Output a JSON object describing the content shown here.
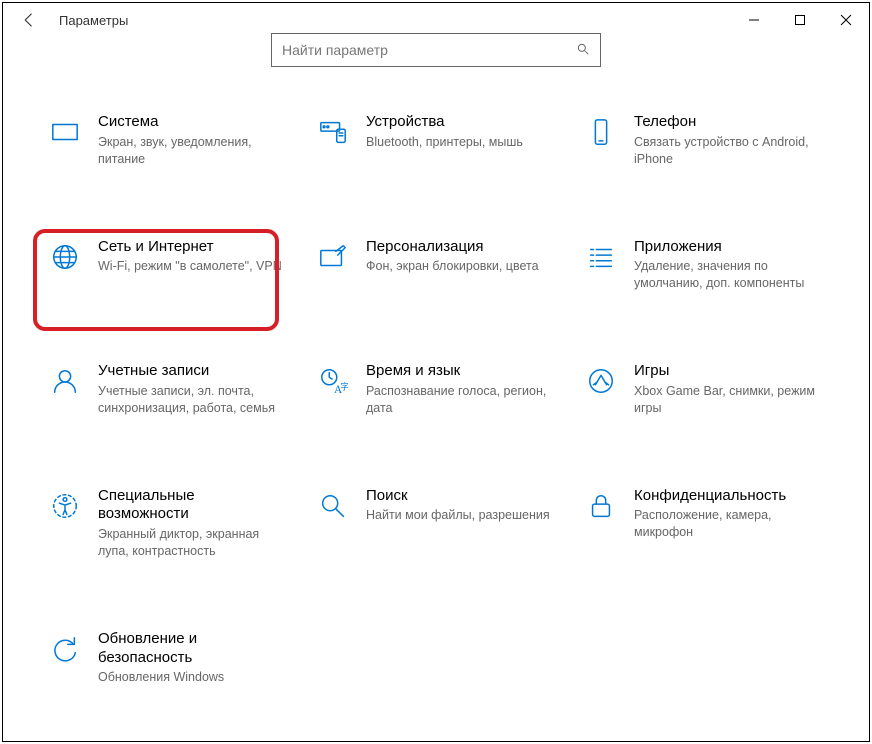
{
  "window": {
    "title": "Параметры"
  },
  "search": {
    "placeholder": "Найти параметр"
  },
  "tiles": [
    {
      "title": "Система",
      "desc": "Экран, звук, уведомления, питание"
    },
    {
      "title": "Устройства",
      "desc": "Bluetooth, принтеры, мышь"
    },
    {
      "title": "Телефон",
      "desc": "Связать устройство с Android, iPhone"
    },
    {
      "title": "Сеть и Интернет",
      "desc": "Wi-Fi, режим \"в самолете\", VPN"
    },
    {
      "title": "Персонализация",
      "desc": "Фон, экран блокировки, цвета"
    },
    {
      "title": "Приложения",
      "desc": "Удаление, значения по умолчанию, доп. компоненты"
    },
    {
      "title": "Учетные записи",
      "desc": "Учетные записи, эл. почта, синхронизация, работа, семья"
    },
    {
      "title": "Время и язык",
      "desc": "Распознавание голоса, регион, дата"
    },
    {
      "title": "Игры",
      "desc": "Xbox Game Bar, снимки, режим игры"
    },
    {
      "title": "Специальные возможности",
      "desc": "Экранный диктор, экранная лупа, контрастность"
    },
    {
      "title": "Поиск",
      "desc": "Найти мои файлы, разрешения"
    },
    {
      "title": "Конфиденциальность",
      "desc": "Расположение, камера, микрофон"
    },
    {
      "title": "Обновление и безопасность",
      "desc": "Обновления Windows"
    }
  ],
  "highlight_index": 3
}
